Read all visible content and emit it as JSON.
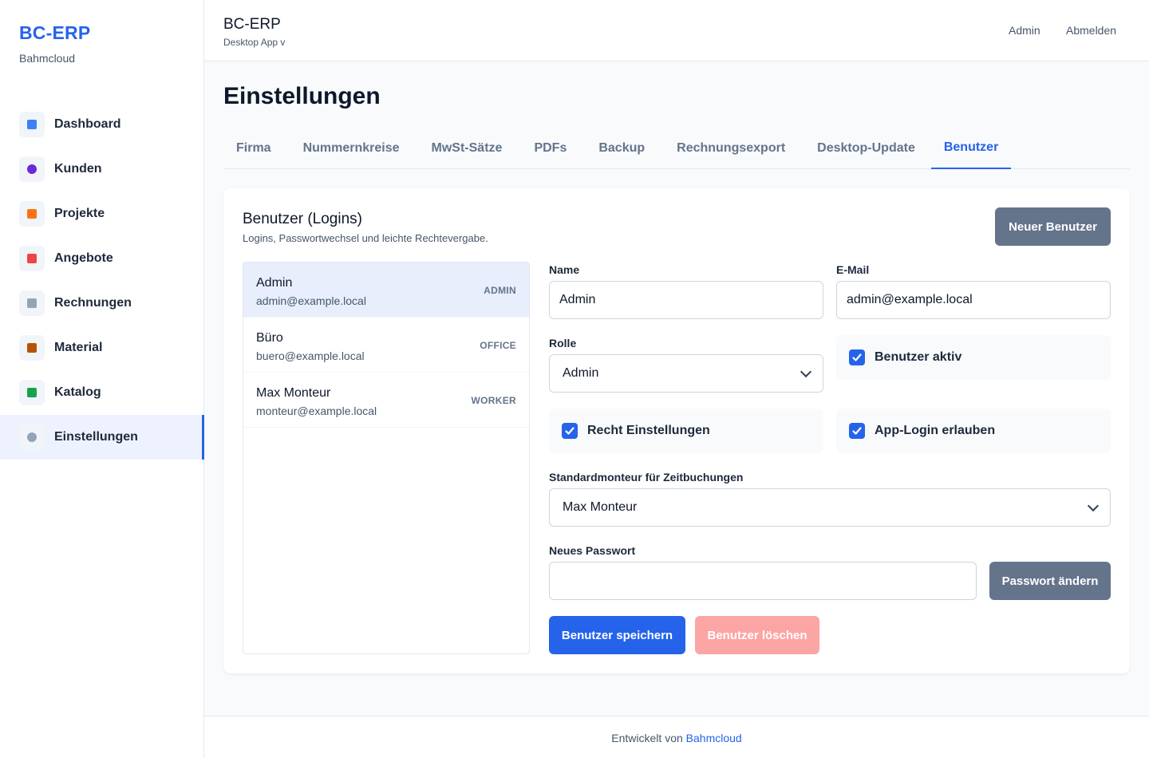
{
  "brand": {
    "title": "BC-ERP",
    "subtitle": "Bahmcloud"
  },
  "sidebar": {
    "items": [
      {
        "label": "Dashboard",
        "icon": "chart-icon",
        "color": "#3b82f6"
      },
      {
        "label": "Kunden",
        "icon": "users-icon",
        "color": "#6d28d9"
      },
      {
        "label": "Projekte",
        "icon": "construction-icon",
        "color": "#f97316"
      },
      {
        "label": "Angebote",
        "icon": "memo-icon",
        "color": "#ef4444"
      },
      {
        "label": "Rechnungen",
        "icon": "receipt-icon",
        "color": "#94a3b8"
      },
      {
        "label": "Material",
        "icon": "package-icon",
        "color": "#b45309"
      },
      {
        "label": "Katalog",
        "icon": "books-icon",
        "color": "#16a34a"
      },
      {
        "label": "Einstellungen",
        "icon": "gear-icon",
        "color": "#94a3b8"
      }
    ],
    "active_index": 7
  },
  "header": {
    "title": "BC-ERP",
    "subtitle": "Desktop App v",
    "user_label": "Admin",
    "logout_label": "Abmelden"
  },
  "page": {
    "title": "Einstellungen"
  },
  "tabs": [
    "Firma",
    "Nummernkreise",
    "MwSt-Sätze",
    "PDFs",
    "Backup",
    "Rechnungsexport",
    "Desktop-Update",
    "Benutzer"
  ],
  "active_tab": "Benutzer",
  "card": {
    "title": "Benutzer (Logins)",
    "subtitle": "Logins, Passwortwechsel und leichte Rechtevergabe.",
    "new_user_label": "Neuer Benutzer"
  },
  "users": [
    {
      "name": "Admin",
      "email": "admin@example.local",
      "role": "ADMIN",
      "selected": true
    },
    {
      "name": "Büro",
      "email": "buero@example.local",
      "role": "OFFICE",
      "selected": false
    },
    {
      "name": "Max Monteur",
      "email": "monteur@example.local",
      "role": "WORKER",
      "selected": false
    }
  ],
  "form": {
    "name_label": "Name",
    "name_value": "Admin",
    "email_label": "E-Mail",
    "email_value": "admin@example.local",
    "role_label": "Rolle",
    "role_value": "Admin",
    "active_label": "Benutzer aktiv",
    "settings_right_label": "Recht Einstellungen",
    "app_login_label": "App-Login erlauben",
    "default_worker_label": "Standardmonteur für Zeitbuchungen",
    "default_worker_value": "Max Monteur",
    "new_password_label": "Neues Passwort",
    "new_password_value": "",
    "change_password_label": "Passwort ändern",
    "save_label": "Benutzer speichern",
    "delete_label": "Benutzer löschen"
  },
  "footer": {
    "prefix": "Entwickelt von",
    "link": "Bahmcloud"
  }
}
